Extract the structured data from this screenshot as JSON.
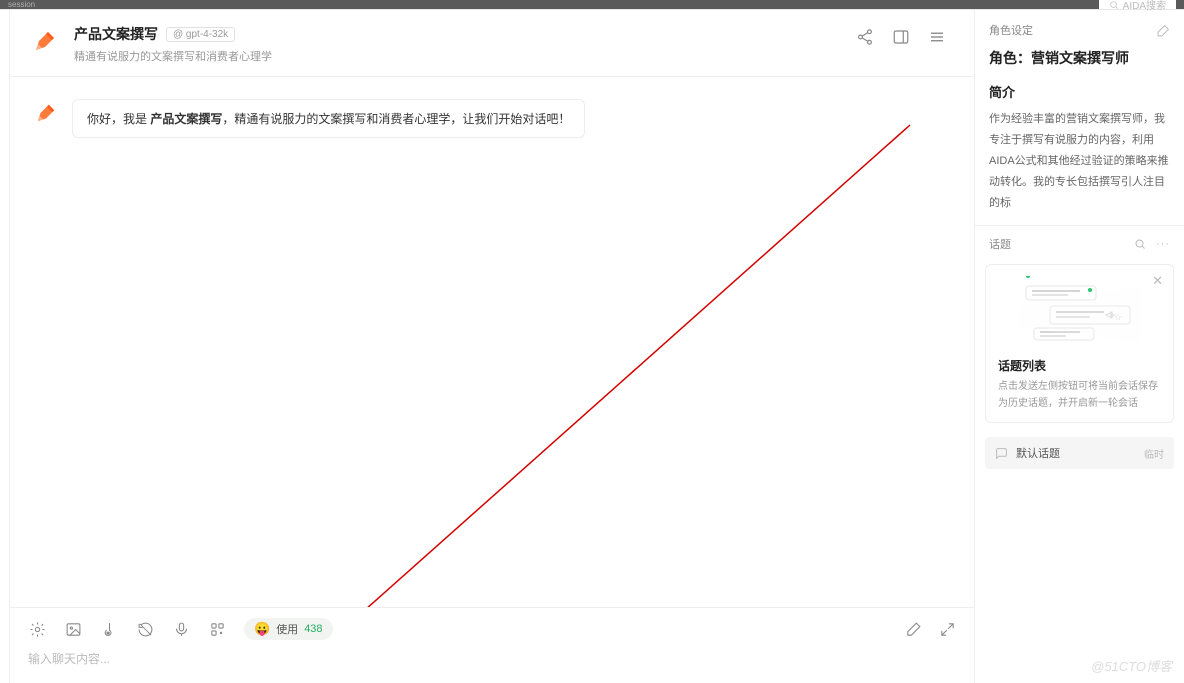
{
  "topbar": {
    "session_fragment": "session",
    "search_placeholder": "AIDA搜索"
  },
  "header": {
    "title": "产品文案撰写",
    "model": "@ gpt-4-32k",
    "subtitle": "精通有说服力的文案撰写和消费者心理学",
    "icons": {
      "share": "share-icon",
      "panel": "panel-toggle-icon",
      "menu": "menu-icon"
    }
  },
  "chat": {
    "avatar": "pencil-icon",
    "greeting_prefix": "你好，我是 ",
    "greeting_bold": "产品文案撰写",
    "greeting_suffix": "，精通有说服力的文案撰写和消费者心理学，让我们开始对话吧！"
  },
  "toolbar": {
    "icons": [
      "settings",
      "image",
      "thermometer",
      "history",
      "mic",
      "apps"
    ],
    "token_label": "使用",
    "token_count": "438",
    "right_icons": [
      "eraser",
      "expand"
    ],
    "input_placeholder": "输入聊天内容..."
  },
  "right": {
    "role_section_label": "角色设定",
    "role_prefix": "角色：",
    "role_value": "营销文案撰写师",
    "intro_head": "简介",
    "intro_body": "作为经验丰富的营销文案撰写师，我专注于撰写有说服力的内容，利用AIDA公式和其他经过验证的策略来推动转化。我的专长包括撰写引人注目的标",
    "topics_label": "话题",
    "topic_card": {
      "title": "话题列表",
      "desc": "点击发送左侧按钮可将当前会话保存为历史话题，并开启新一轮会话"
    },
    "default_topic": {
      "name": "默认话题",
      "tag": "临时"
    }
  },
  "watermark": "@51CTO博客"
}
